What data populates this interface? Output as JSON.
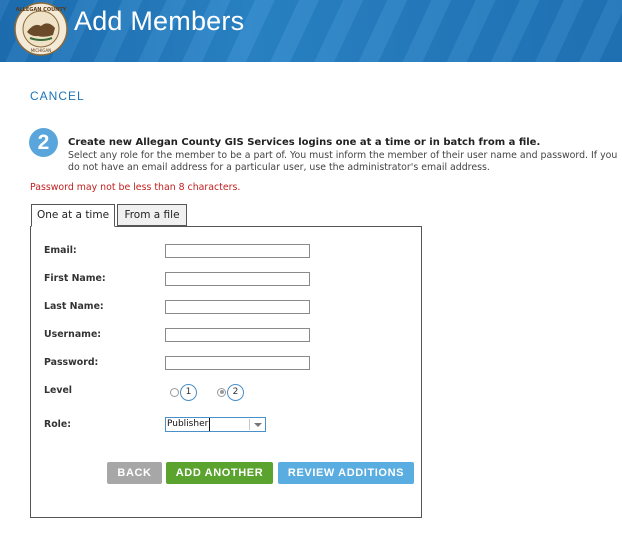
{
  "header": {
    "title": "Add Members",
    "seal_text": "ALLEGAN COUNTY",
    "seal_subtext": "MICHIGAN",
    "brand_color": "#1f74b8"
  },
  "actions": {
    "cancel_label": "CANCEL"
  },
  "step": {
    "number": "2",
    "heading": "Create new Allegan County GIS Services logins one at a time or in batch from a file.",
    "description": "Select any role for the member to be a part of. You must inform the member of their user name and password. If you do not have an email address for a particular user, use the administrator's email address."
  },
  "error": {
    "message": "Password may not be less than 8 characters.",
    "color": "#c21f1f"
  },
  "tabs": [
    {
      "label": "One at a time",
      "active": true
    },
    {
      "label": "From a file",
      "active": false
    }
  ],
  "form": {
    "email_label": "Email:",
    "email_value": "",
    "first_name_label": "First Name:",
    "first_name_value": "",
    "last_name_label": "Last Name:",
    "last_name_value": "",
    "username_label": "Username:",
    "username_value": "",
    "password_label": "Password:",
    "password_value": "",
    "level_label": "Level",
    "level_options": [
      "1",
      "2"
    ],
    "level_selected": "2",
    "role_label": "Role:",
    "role_value": "Publisher"
  },
  "buttons": {
    "back_label": "BACK",
    "add_another_label": "ADD ANOTHER",
    "review_label": "REVIEW ADDITIONS",
    "back_color": "#a7a7a7",
    "add_color": "#5ba32f",
    "review_color": "#5aade0"
  }
}
